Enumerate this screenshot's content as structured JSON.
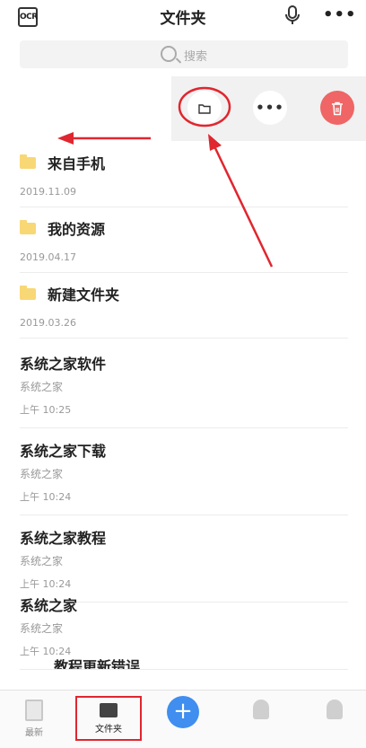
{
  "header": {
    "title": "文件夹",
    "ocr_label": "OCR",
    "more_label": "•••"
  },
  "search": {
    "placeholder": "搜索"
  },
  "action_menu": {
    "more_label": "•••"
  },
  "folders": [
    {
      "name": "来自手机",
      "date": "2019.11.09"
    },
    {
      "name": "我的资源",
      "date": "2019.04.17"
    },
    {
      "name": "新建文件夹",
      "date": "2019.03.26"
    }
  ],
  "documents": [
    {
      "title": "系统之家软件",
      "folder": "系统之家",
      "time": "上午 10:25"
    },
    {
      "title": "系统之家下载",
      "folder": "系统之家",
      "time": "上午 10:24"
    },
    {
      "title": "系统之家教程",
      "folder": "系统之家",
      "time": "上午 10:24"
    },
    {
      "title": "系统之家",
      "folder": "系统之家",
      "time": "上午 10:24"
    }
  ],
  "partial_item": {
    "title": "教程更新错误"
  },
  "tabs": {
    "new": "最新",
    "folder": "文件夹",
    "add": "+"
  },
  "colors": {
    "accent": "#3f8ef0",
    "delete": "#f06565",
    "folder": "#f8d775",
    "annotation": "#e0262f"
  }
}
